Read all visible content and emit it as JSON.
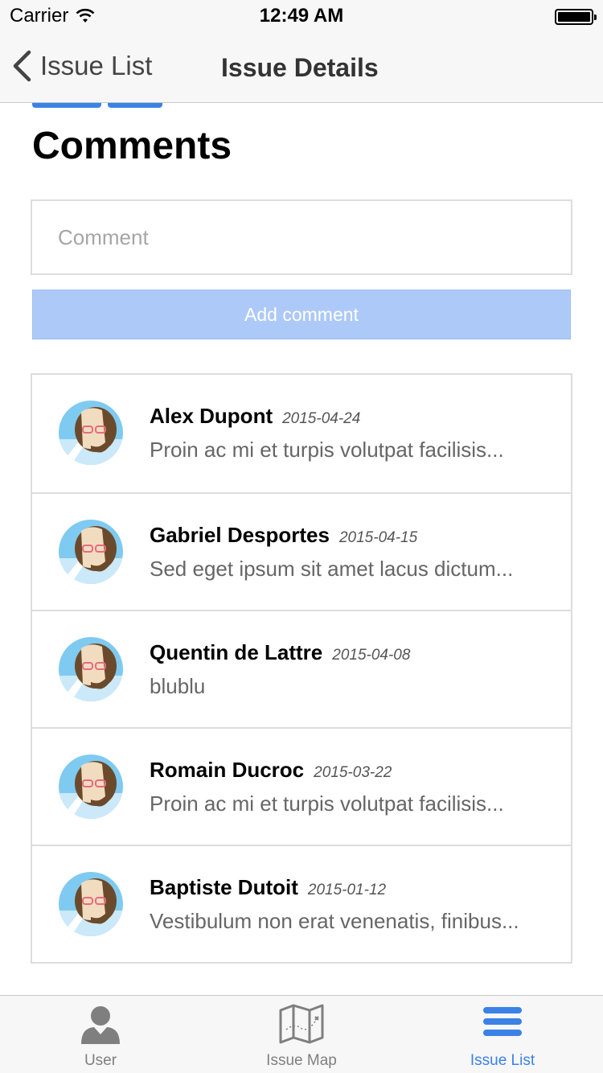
{
  "status_bar": {
    "carrier": "Carrier",
    "time": "12:49 AM"
  },
  "nav": {
    "back_label": "Issue List",
    "title": "Issue Details"
  },
  "comments": {
    "title": "Comments",
    "input_placeholder": "Comment",
    "add_button": "Add comment",
    "items": [
      {
        "author": "Alex Dupont",
        "date": "2015-04-24",
        "text": "Proin ac mi et turpis volutpat facilisis..."
      },
      {
        "author": "Gabriel Desportes",
        "date": "2015-04-15",
        "text": "Sed eget ipsum sit amet lacus dictum..."
      },
      {
        "author": "Quentin de Lattre",
        "date": "2015-04-08",
        "text": "blublu"
      },
      {
        "author": "Romain Ducroc",
        "date": "2015-03-22",
        "text": "Proin ac mi et turpis volutpat facilisis..."
      },
      {
        "author": "Baptiste Dutoit",
        "date": "2015-01-12",
        "text": "Vestibulum non erat venenatis, finibus..."
      }
    ]
  },
  "tabs": [
    {
      "label": "User",
      "icon": "user-icon",
      "active": false
    },
    {
      "label": "Issue Map",
      "icon": "map-icon",
      "active": false
    },
    {
      "label": "Issue List",
      "icon": "list-icon",
      "active": true
    }
  ],
  "colors": {
    "accent": "#3b82e6",
    "button_bg": "#adc9f7",
    "border": "#dddddd",
    "bar_bg": "#f7f7f7"
  }
}
